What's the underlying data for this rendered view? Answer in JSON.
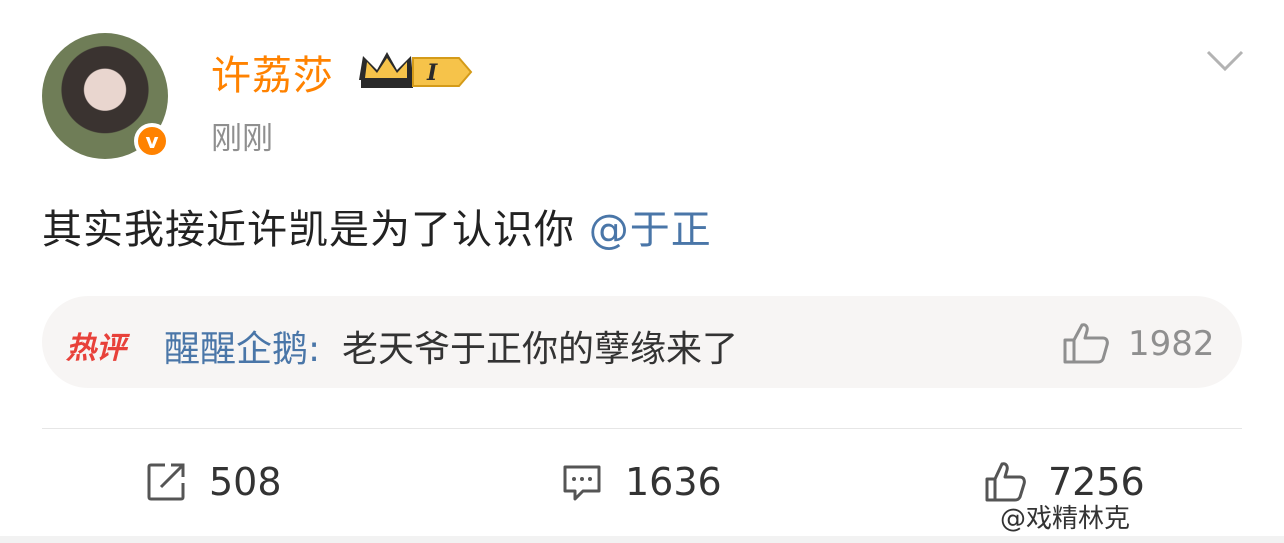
{
  "post": {
    "username": "许荔莎",
    "badge_level": "I",
    "time": "刚刚",
    "text": "其实我接近许凯是为了认识你 ",
    "mention": "@于正"
  },
  "hot_comment": {
    "badge": "热评",
    "author": "醒醒企鹅:",
    "text": " 老天爷于正你的孽缘来了",
    "likes": "1982"
  },
  "actions": {
    "repost_count": "508",
    "comment_count": "1636",
    "like_count": "7256"
  },
  "watermark": "@戏精林克",
  "colors": {
    "username": "#ff8200",
    "link": "#4a76a8",
    "hot_badge": "#e8413a",
    "muted": "#8f8f8f"
  },
  "icons": [
    "verified-icon",
    "crown-icon",
    "chevron-down-icon",
    "thumbs-up-icon",
    "repost-icon",
    "comment-icon",
    "like-icon"
  ]
}
